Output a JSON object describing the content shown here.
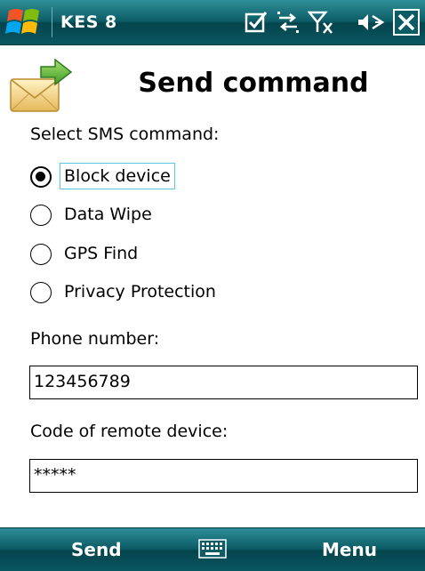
{
  "statusbar": {
    "app_title": "KES 8",
    "icons": [
      "start-icon",
      "notification-icon",
      "connectivity-icon",
      "signal-off-icon",
      "volume-off-icon",
      "close-icon"
    ]
  },
  "header": {
    "title": "Send command",
    "icon": "envelope-send-icon"
  },
  "form": {
    "command_label": "Select SMS command:",
    "commands": [
      {
        "label": "Block device",
        "selected": true
      },
      {
        "label": "Data Wipe",
        "selected": false
      },
      {
        "label": "GPS Find",
        "selected": false
      },
      {
        "label": "Privacy Protection",
        "selected": false
      }
    ],
    "phone_label": "Phone number:",
    "phone_value": "123456789",
    "code_label": "Code of remote device:",
    "code_value": "*****"
  },
  "softkeys": {
    "left": "Send",
    "center_icon": "keyboard-icon",
    "right": "Menu"
  },
  "colors": {
    "bar_dark": "#04444d",
    "bar_light": "#2f8f98",
    "focus_border": "#5bc7e0"
  }
}
